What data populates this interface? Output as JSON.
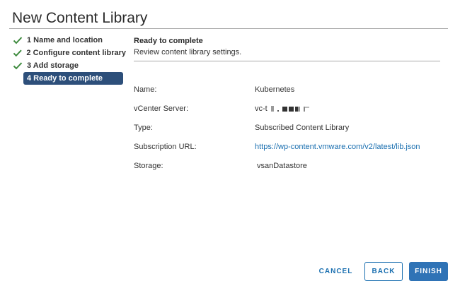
{
  "dialog": {
    "title": "New Content Library"
  },
  "steps": [
    {
      "label": "1 Name and location",
      "state": "complete"
    },
    {
      "label": "2 Configure content library",
      "state": "complete"
    },
    {
      "label": "3 Add storage",
      "state": "complete"
    },
    {
      "label": "4 Ready to complete",
      "state": "active"
    }
  ],
  "content": {
    "title": "Ready to complete",
    "subtitle": "Review content library settings."
  },
  "properties": {
    "name_label": "Name:",
    "name_value": "Kubernetes",
    "vcenter_label": "vCenter Server:",
    "vcenter_value": "vc-t",
    "type_label": "Type:",
    "type_value": "Subscribed Content Library",
    "url_label": "Subscription URL:",
    "url_value": "https://wp-content.vmware.com/v2/latest/lib.json",
    "storage_label": "Storage:",
    "storage_value": "vsanDatastore"
  },
  "footer": {
    "cancel_label": "CANCEL",
    "back_label": "BACK",
    "finish_label": "FINISH"
  },
  "colors": {
    "accent": "#2f73b6",
    "active_step": "#2d4f7a",
    "check": "#3d8a3d",
    "link": "#1a6fb0"
  }
}
